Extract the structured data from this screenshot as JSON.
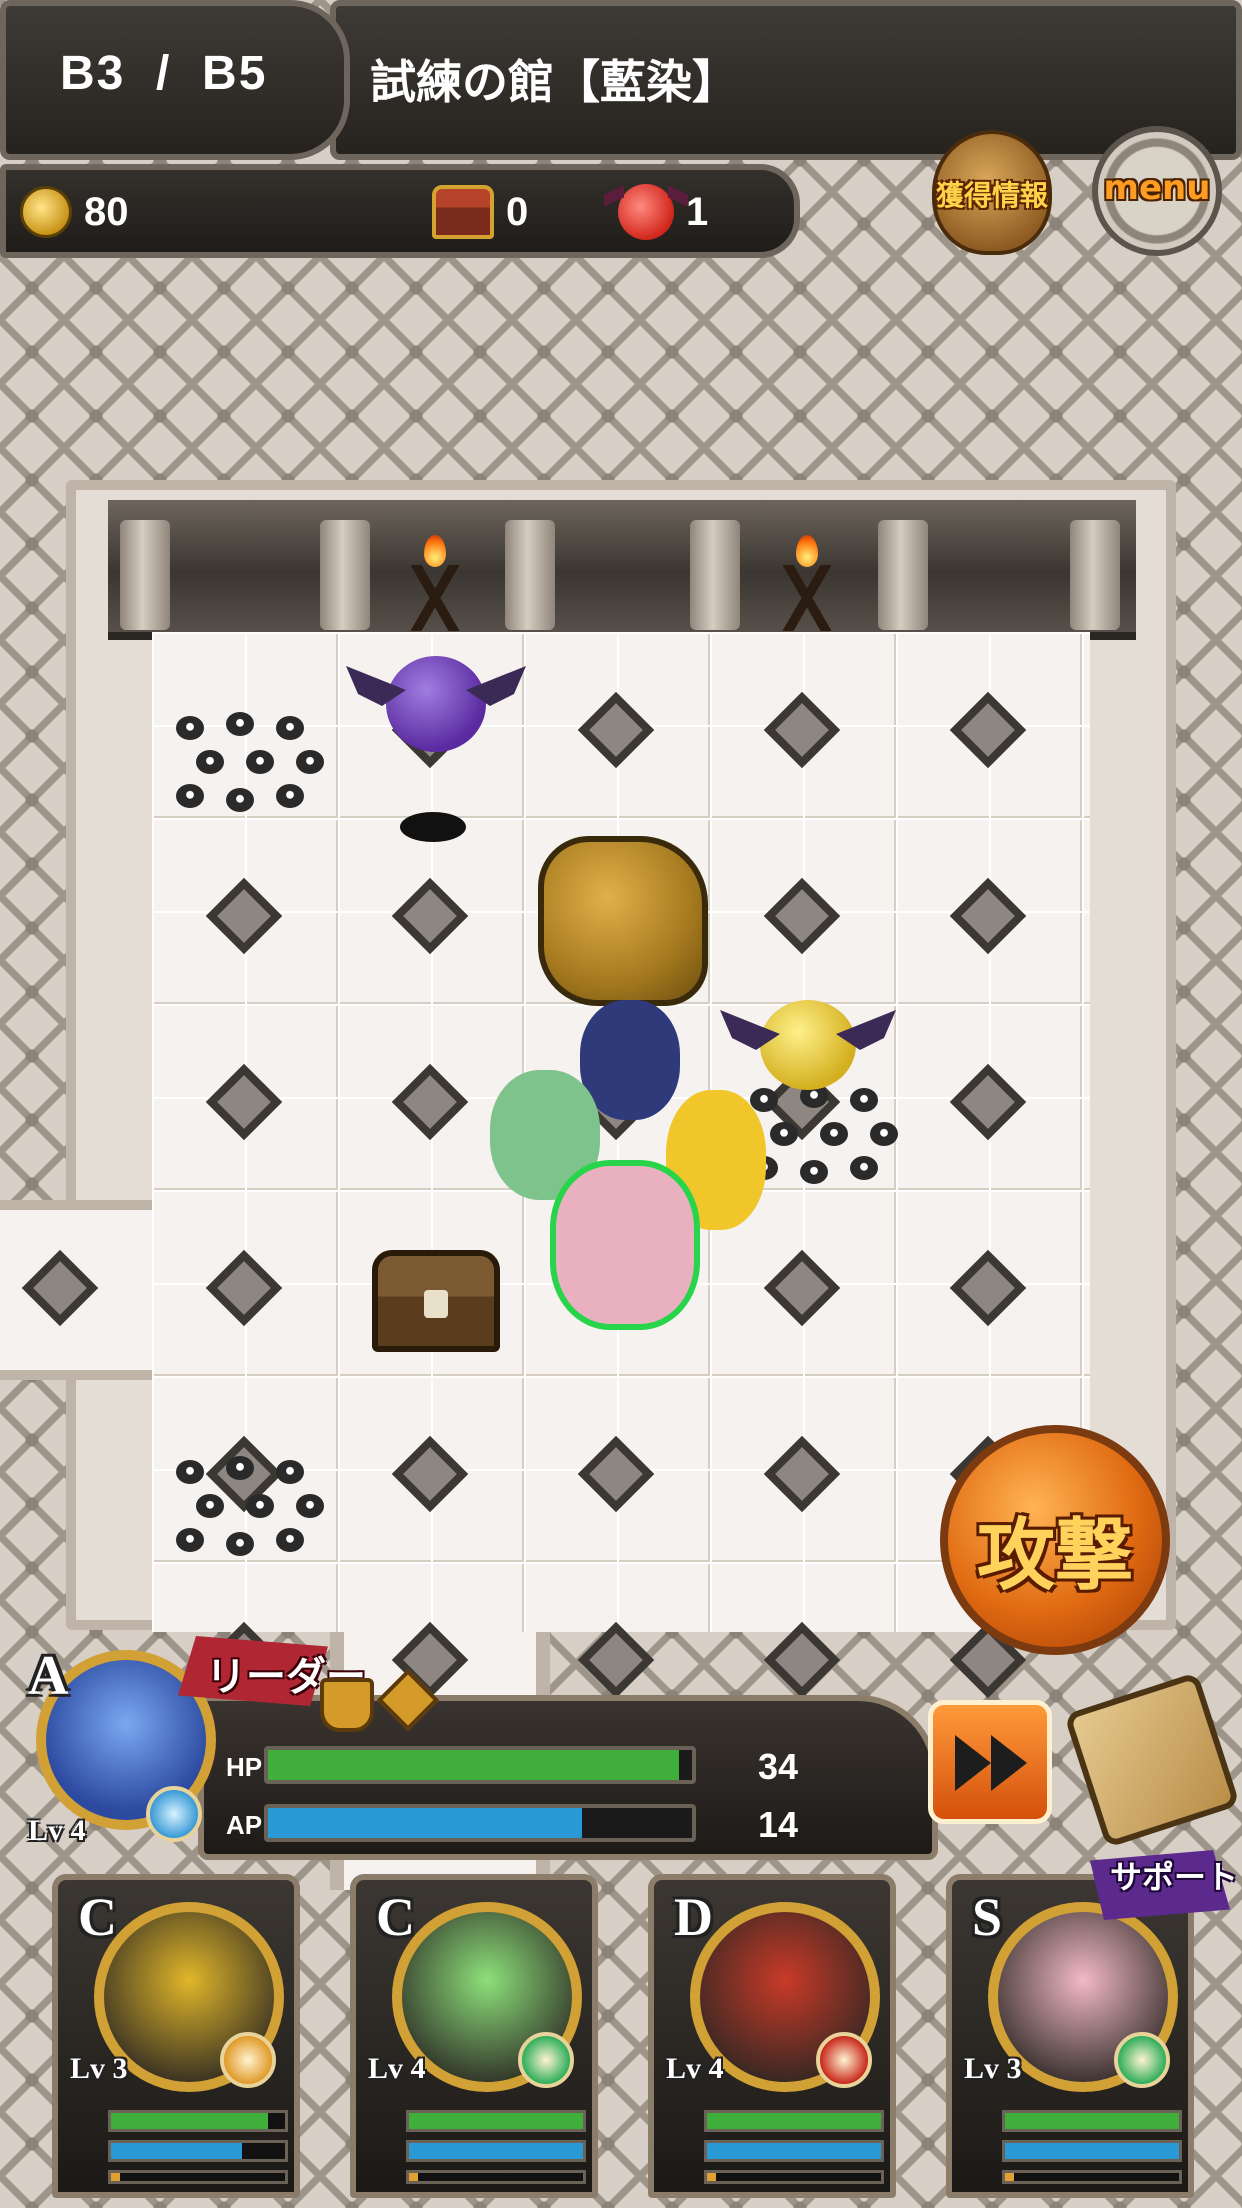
{
  "header": {
    "floor_label": "B3  /  B5",
    "dungeon_name": "試練の館【藍染】"
  },
  "stats": {
    "coins": "80",
    "chests": "0",
    "captured": "1"
  },
  "buttons": {
    "acquired_info": "獲得情報",
    "menu": "menu",
    "attack": "攻撃"
  },
  "leader": {
    "tag": "リーダー",
    "rank": "A",
    "level": "4",
    "hp_label": "HP",
    "ap_label": "AP",
    "hp_value": "34",
    "ap_value": "14",
    "hp_fraction": 0.97,
    "ap_fraction": 0.74,
    "element": "water"
  },
  "party": [
    {
      "rank": "C",
      "level": "3",
      "element": "earth",
      "portrait_color": "#e0b62a",
      "hp_fraction": 0.9,
      "ap_fraction": 0.75,
      "xp_fraction": 0.05
    },
    {
      "rank": "C",
      "level": "4",
      "element": "wind",
      "portrait_color": "#8de07a",
      "hp_fraction": 1.0,
      "ap_fraction": 1.0,
      "xp_fraction": 0.05
    },
    {
      "rank": "D",
      "level": "4",
      "element": "fire",
      "portrait_color": "#c93a28",
      "hp_fraction": 1.0,
      "ap_fraction": 1.0,
      "xp_fraction": 0.05
    },
    {
      "rank": "S",
      "level": "3",
      "element": "wind",
      "portrait_color": "#f2b9c6",
      "hp_fraction": 1.0,
      "ap_fraction": 1.0,
      "xp_fraction": 0.05
    }
  ],
  "support_tag": "サポート",
  "level_prefix": "Lv",
  "icons": {
    "coin": "coin-icon",
    "chest": "treasure-chest-icon",
    "captured": "red-imp-icon",
    "fast_forward": "fast-forward-icon",
    "map": "map-scroll-icon"
  },
  "colors": {
    "hp": "#3fae3a",
    "ap": "#2a9ad6",
    "xp": "#e0a034",
    "highlight": "#27d44a"
  }
}
